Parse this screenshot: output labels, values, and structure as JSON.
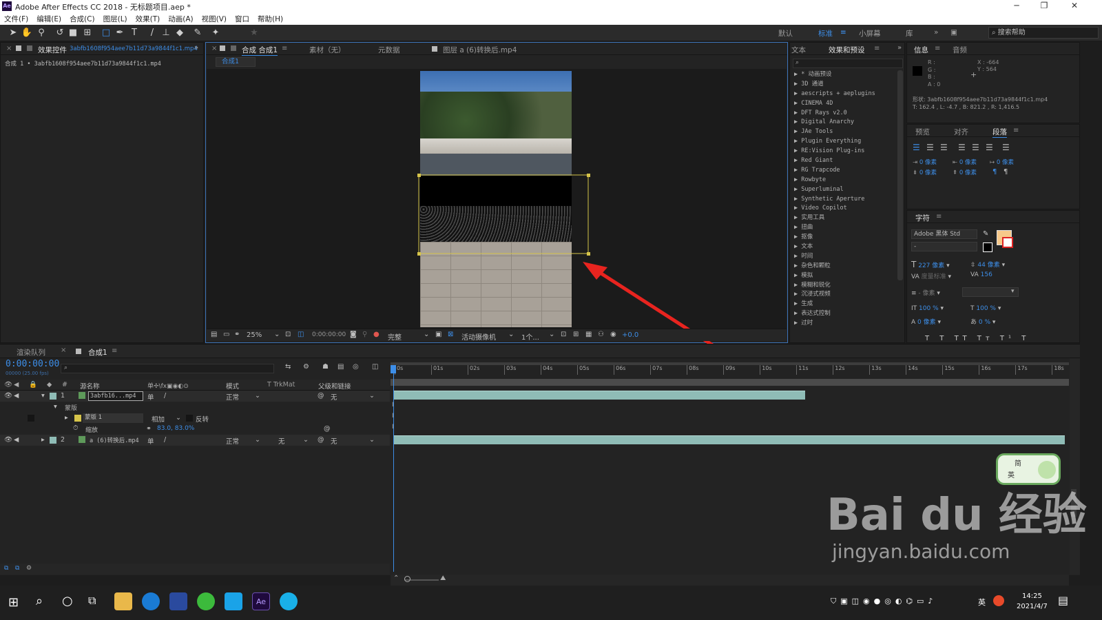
{
  "window": {
    "title": "Adobe After Effects CC 2018 - 无标题项目.aep *",
    "logo": "Ae",
    "controls": [
      "─",
      "❐",
      "✕"
    ]
  },
  "menu": [
    "文件(F)",
    "编辑(E)",
    "合成(C)",
    "图层(L)",
    "效果(T)",
    "动画(A)",
    "视图(V)",
    "窗口",
    "帮助(H)"
  ],
  "workspaces": {
    "default": "默认",
    "standard": "标准",
    "small": "小屏幕",
    "library": "库",
    "more": "»",
    "search_placeholder": "搜索帮助"
  },
  "effect_controls": {
    "tab_label": "效果控件",
    "tab_file": "3abfb1608f954aee7b11d73a9844f1c1.mp4",
    "path": "合成 1 • 3abfb1608f954aee7b11d73a9844f1c1.mp4"
  },
  "viewer": {
    "tabs": [
      "合成 合成1",
      "素材（无）",
      "元数据",
      "图层 a (6)转换后.mp4"
    ],
    "subtab": "合成1",
    "zoom": "25%",
    "timecode": "0:00:00:00",
    "resolution": "完整",
    "camera": "活动摄像机",
    "views": "1个...",
    "exposure": "+0.0"
  },
  "effects_panel": {
    "tabs": [
      "文本",
      "效果和预设"
    ],
    "items": [
      "* 动画预设",
      "3D 通道",
      "aescripts + aeplugins",
      "CINEMA 4D",
      "DFT Rays v2.0",
      "Digital Anarchy",
      "JAe Tools",
      "Plugin Everything",
      "RE:Vision Plug-ins",
      "Red Giant",
      "RG Trapcode",
      "Rowbyte",
      "Superluminal",
      "Synthetic Aperture",
      "Video Copilot",
      "实用工具",
      "扭曲",
      "抠像",
      "文本",
      "时间",
      "杂色和颗粒",
      "模拟",
      "模糊和锐化",
      "沉浸式视频",
      "生成",
      "表达式控制",
      "过时"
    ]
  },
  "info_panel": {
    "tabs": [
      "信息",
      "音频"
    ],
    "rgba": [
      "R :",
      "G :",
      "B :",
      "A : 0"
    ],
    "x": "X : -664",
    "y": "Y : 564",
    "shape_line1": "形状: 3abfb1608f954aee7b11d73a9844f1c1.mp4",
    "shape_line2": "T: 162.4 ,  L: -4.7 ,  B: 821.2 ,  R: 1,416.5"
  },
  "paragraph_panel": {
    "tabs": [
      "预览",
      "对齐",
      "段落"
    ],
    "zero_px": "0 像素"
  },
  "character_panel": {
    "title": "字符",
    "font": "Adobe 黑体 Std",
    "style": "-",
    "size": "227 像素",
    "leading": "44 像素",
    "kerning": "度量标准",
    "tracking": "156",
    "stroke": "- 像素",
    "vscale": "100 %",
    "hscale": "100 %",
    "baseline": "0 像素",
    "tsume": "0 %",
    "fill_color": "#f7c98a"
  },
  "timeline": {
    "tabs": [
      "渲染队列",
      "合成1"
    ],
    "timecode": "0:00:00:00",
    "fps": "00000 (25.00 fps)",
    "columns": {
      "source": "源名称",
      "mode": "模式",
      "trk": "T  TrkMat",
      "parent": "父级和链接"
    },
    "layers": [
      {
        "num": "1",
        "name": "3abfb16...mp4",
        "mode": "正常",
        "parent": "无"
      },
      {
        "num": "2",
        "name": "a (6)转换后.mp4",
        "mode": "正常",
        "trkmat": "无",
        "parent": "无"
      }
    ],
    "mask_group": "蒙版",
    "mask_name": "蒙版 1",
    "mask_mode": "相加",
    "mask_invert": "反转",
    "scale_label": "缩放",
    "scale_value": "83.0, 83.0%",
    "ruler": [
      "0s",
      "01s",
      "02s",
      "03s",
      "04s",
      "05s",
      "06s",
      "07s",
      "08s",
      "09s",
      "10s",
      "11s",
      "12s",
      "13s",
      "14s",
      "15s",
      "16s",
      "17s",
      "18s"
    ]
  },
  "taskbar": {
    "time": "14:25",
    "date": "2021/4/7",
    "ime": "英",
    "ime_badge": [
      "简",
      "英"
    ]
  },
  "watermark": {
    "brand": "Bai du 经验",
    "url": "jingyan.baidu.com"
  },
  "colors": {
    "accent": "#3d8ee8",
    "arrow": "#e8241f",
    "mask_path": "#d6c44a",
    "layer_bar": "#8fbcb6"
  }
}
